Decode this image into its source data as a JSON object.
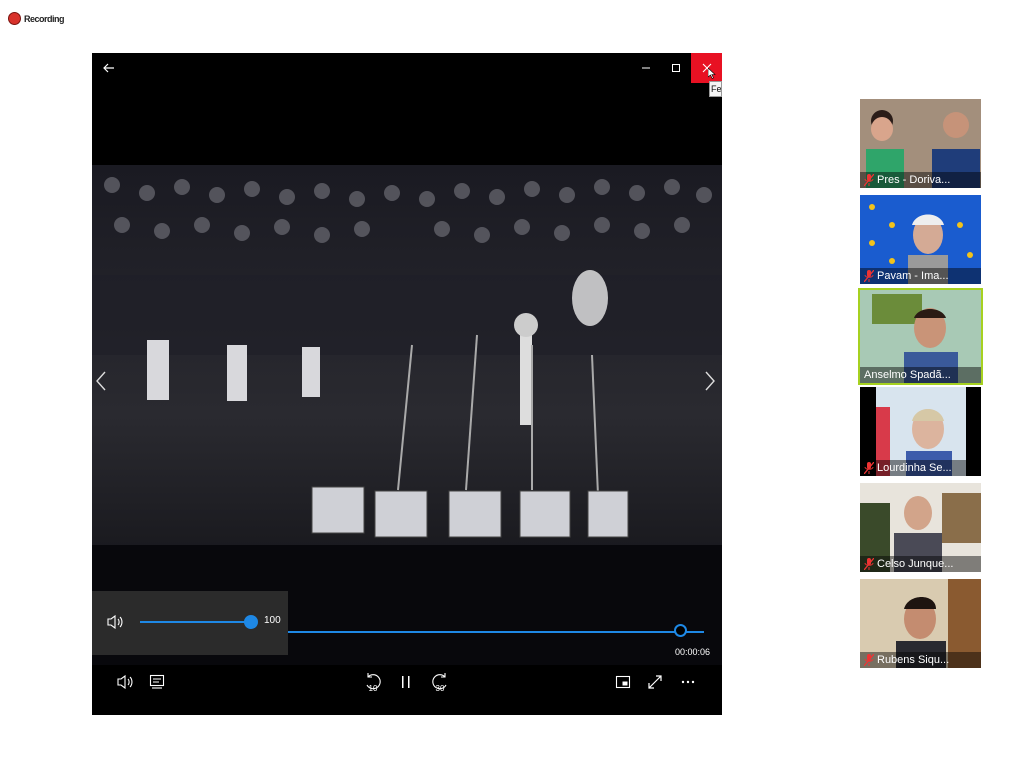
{
  "recording": {
    "label": "Recording"
  },
  "player": {
    "tooltip": "Fe",
    "volume_value": "100",
    "volume_level": 1.0,
    "progress": 0.97,
    "time": "00:00:06",
    "icons": {
      "back": "back-arrow-icon",
      "minimize": "minimize-icon",
      "maximize": "maximize-icon",
      "close": "close-icon",
      "volume": "speaker-icon",
      "captions": "captions-icon",
      "skip_back": "skip-back-10-icon",
      "pause": "pause-icon",
      "skip_forward": "skip-forward-30-icon",
      "mini_view": "mini-view-icon",
      "fullscreen": "fullscreen-icon",
      "more": "more-icon"
    },
    "close_color": "#e81123",
    "accent_color": "#1e88e5",
    "skip_back_seconds": "10",
    "skip_forward_seconds": "30"
  },
  "participants": [
    {
      "name": "Pres - Doriva...",
      "muted": true,
      "active": false
    },
    {
      "name": "Pavam - Ima...",
      "muted": true,
      "active": false
    },
    {
      "name": "Anselmo Spadã...",
      "muted": false,
      "active": true
    },
    {
      "name": "Lourdinha Se...",
      "muted": true,
      "active": false
    },
    {
      "name": "Celso Junque...",
      "muted": true,
      "active": false
    },
    {
      "name": "Rubens Siqu...",
      "muted": true,
      "active": false
    }
  ],
  "active_speaker_color": "#a6d120"
}
